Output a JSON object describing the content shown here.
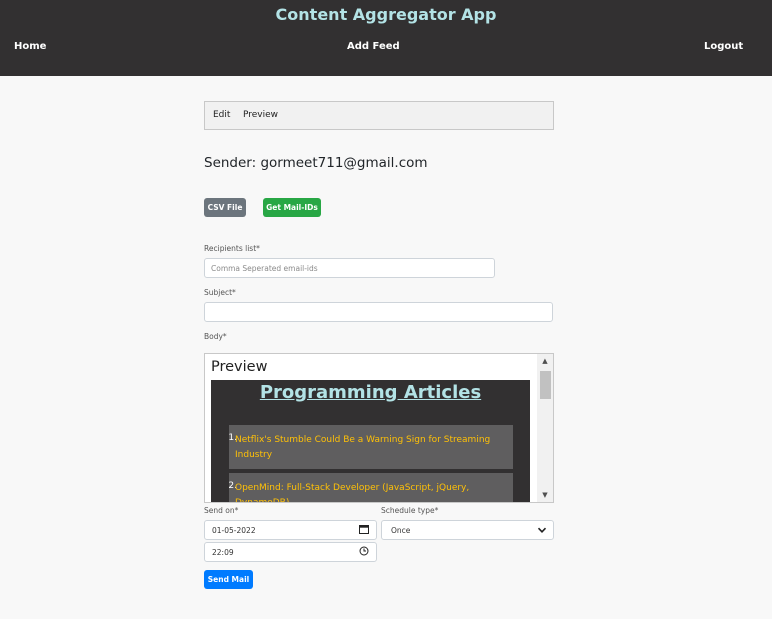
{
  "header": {
    "title": "Content Aggregator App",
    "nav": {
      "home": "Home",
      "add_feed": "Add Feed",
      "logout": "Logout"
    }
  },
  "editor_tabs": {
    "edit": "Edit",
    "preview": "Preview"
  },
  "sender": "Sender: gormeet711@gmail.com",
  "buttons": {
    "csv": "CSV File",
    "get_mails": "Get Mail-IDs",
    "send": "Send Mail"
  },
  "form": {
    "recipients_label": "Recipients list*",
    "recipients_placeholder": "Comma Seperated email-ids",
    "subject_label": "Subject*",
    "subject_value": "",
    "body_label": "Body*",
    "send_on_label": "Send on*",
    "date_value": "01-05-2022",
    "time_value": "22:09",
    "schedule_label": "Schedule type*",
    "schedule_value": "Once"
  },
  "preview": {
    "heading": "Preview",
    "articles_title": "Programming Articles",
    "articles": [
      {
        "num": "1.",
        "title": "Netflix's Stumble Could Be a Warning Sign for Streaming Industry"
      },
      {
        "num": "2.",
        "title": "OpenMind: Full-Stack Developer (JavaScript, jQuery, DynamoDB)"
      }
    ]
  },
  "icons": {
    "calendar": "calendar-icon",
    "clock": "clock-icon",
    "chevron": "chevron-down-icon"
  },
  "colors": {
    "navbar": "#323031",
    "accent_title": "#b3e3e6",
    "csv_button": "#6c757d",
    "mail_button": "#28a745",
    "send_button": "#007bff",
    "article_link": "#ffc107"
  }
}
